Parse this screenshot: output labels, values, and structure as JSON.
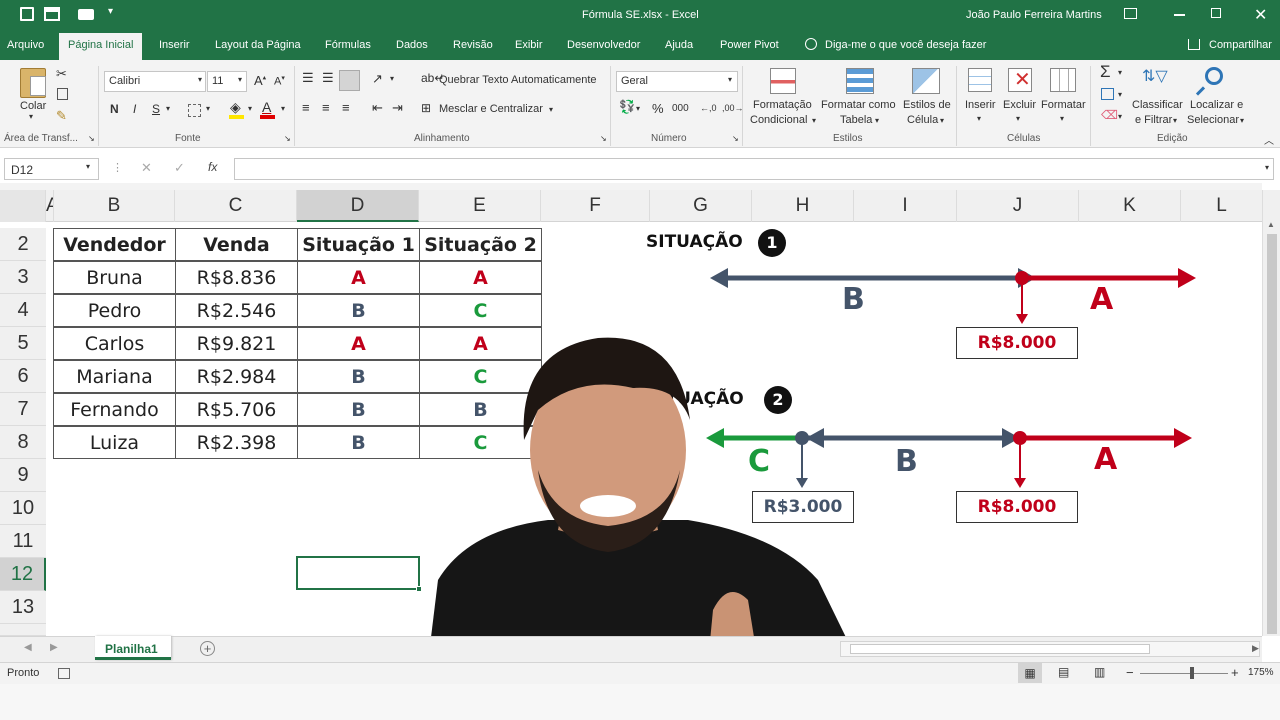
{
  "window": {
    "title": "Fórmula SE.xlsx  -  Excel",
    "user": "João Paulo Ferreira Martins"
  },
  "tabs": [
    "Arquivo",
    "Página Inicial",
    "Inserir",
    "Layout da Página",
    "Fórmulas",
    "Dados",
    "Revisão",
    "Exibir",
    "Desenvolvedor",
    "Ajuda",
    "Power Pivot"
  ],
  "tell_me": "Diga-me o que você deseja fazer",
  "share": "Compartilhar",
  "ribbon": {
    "paste": "Colar",
    "clipboard_group": "Área de Transf...",
    "font_name": "Calibri",
    "font_size": "11",
    "bold": "N",
    "italic": "I",
    "underline": "S",
    "font_group": "Fonte",
    "wrap_text": "Quebrar Texto Automaticamente",
    "merge_center": "Mesclar e Centralizar",
    "alignment_group": "Alinhamento",
    "number_format": "Geral",
    "percent": "%",
    "thousands": "000",
    "number_group": "Número",
    "cond_format_1": "Formatação",
    "cond_format_2": "Condicional",
    "format_table_1": "Formatar como",
    "format_table_2": "Tabela",
    "cell_styles_1": "Estilos de",
    "cell_styles_2": "Célula",
    "styles_group": "Estilos",
    "insert": "Inserir",
    "delete": "Excluir",
    "format": "Formatar",
    "cells_group": "Células",
    "sort_1": "Classificar",
    "sort_2": "e Filtrar",
    "find_1": "Localizar e",
    "find_2": "Selecionar",
    "editing_group": "Edição"
  },
  "formula_bar": {
    "name_box": "D12",
    "fx": "fx",
    "content": ""
  },
  "columns": [
    "A",
    "B",
    "C",
    "D",
    "E",
    "F",
    "G",
    "H",
    "I",
    "J",
    "K",
    "L"
  ],
  "rows": [
    "2",
    "3",
    "4",
    "5",
    "6",
    "7",
    "8",
    "9",
    "10",
    "11",
    "12",
    "13"
  ],
  "table": {
    "headers": [
      "Vendedor",
      "Venda",
      "Situação 1",
      "Situação 2"
    ],
    "rows": [
      [
        "Bruna",
        "R$8.836",
        "A",
        "A"
      ],
      [
        "Pedro",
        "R$2.546",
        "B",
        "C"
      ],
      [
        "Carlos",
        "R$9.821",
        "A",
        "A"
      ],
      [
        "Mariana",
        "R$2.984",
        "B",
        "C"
      ],
      [
        "Fernando",
        "R$5.706",
        "B",
        "B"
      ],
      [
        "Luiza",
        "R$2.398",
        "B",
        "C"
      ]
    ]
  },
  "diagram": {
    "sit1_title": "SITUAÇÃO",
    "sit1_num": "1",
    "sit1_label_b": "B",
    "sit1_label_a": "A",
    "sit1_value": "R$8.000",
    "sit2_title": "SITUAÇÃO",
    "sit2_num": "2",
    "sit2_label_c": "C",
    "sit2_label_b": "B",
    "sit2_label_a": "A",
    "sit2_value_low": "R$3.000",
    "sit2_value_high": "R$8.000"
  },
  "sheet_tab": "Planilha1",
  "status": {
    "ready": "Pronto",
    "zoom": "175%"
  },
  "colors": {
    "excel_green": "#217346",
    "red": "#c0001a",
    "slate": "#44546a",
    "green": "#1a9a3c"
  }
}
